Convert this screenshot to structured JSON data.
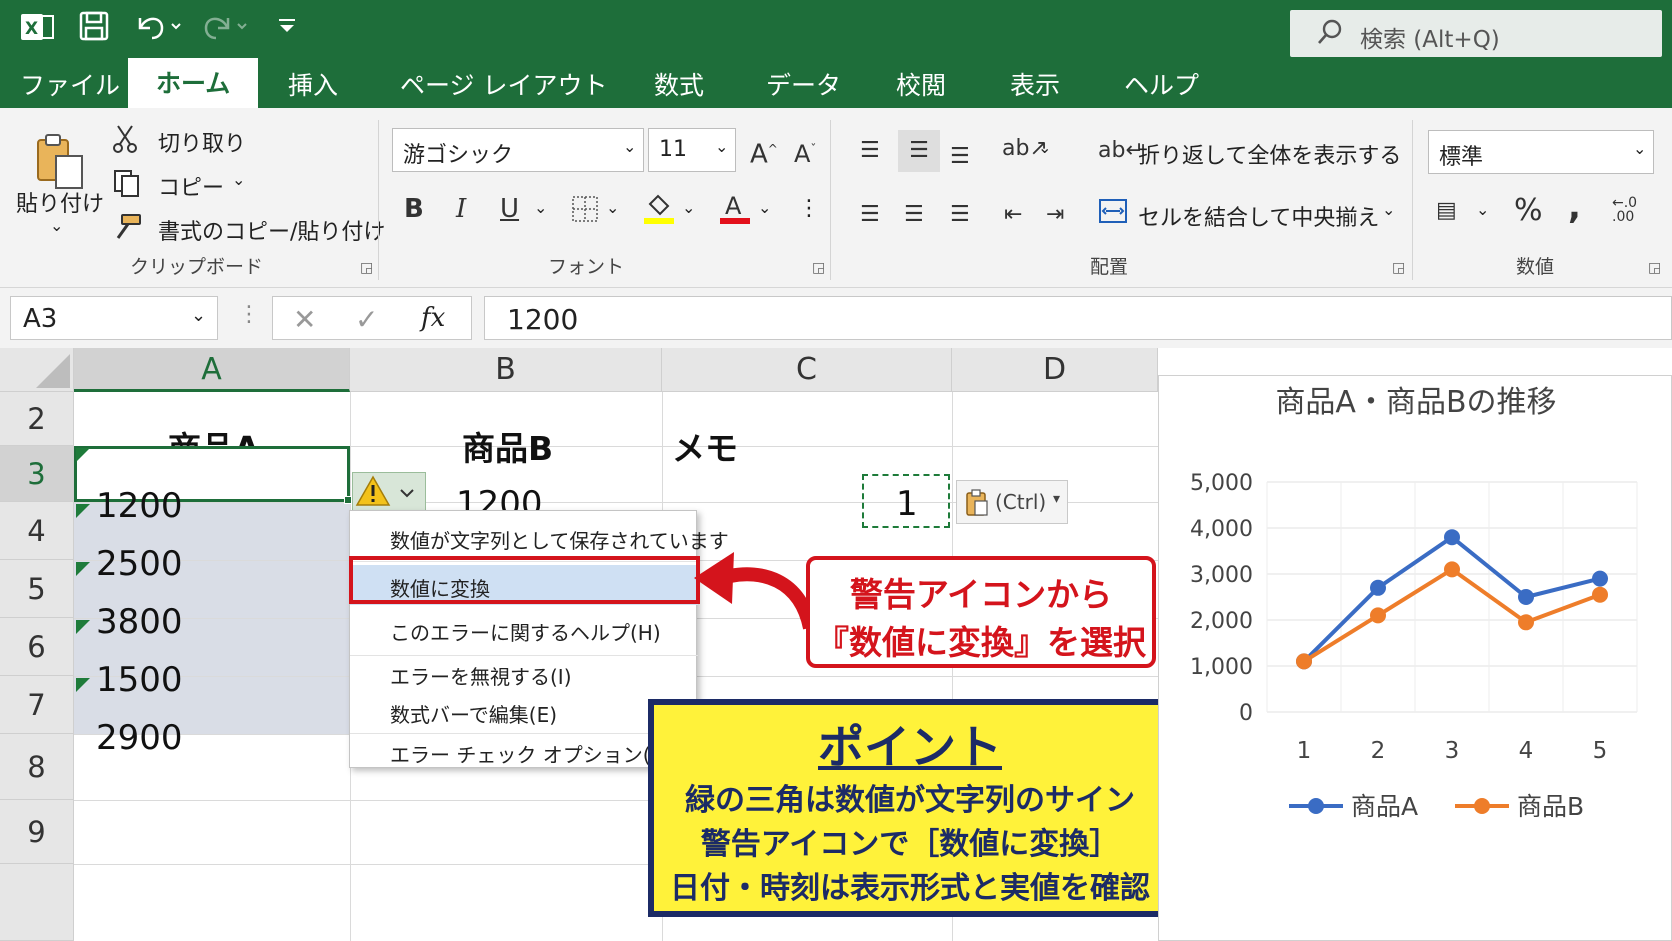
{
  "window": {
    "search_placeholder": "検索 (Alt+Q)",
    "tabs": [
      "ファイル",
      "ホーム",
      "挿入",
      "ページ レイアウト",
      "数式",
      "データ",
      "校閲",
      "表示",
      "ヘルプ"
    ],
    "active_tab": "ホーム"
  },
  "ribbon": {
    "clipboard": {
      "paste": "貼り付け",
      "cut": "切り取り",
      "copy": "コピー",
      "format_painter": "書式のコピー/貼り付け",
      "group": "クリップボード"
    },
    "font": {
      "font_name": "游ゴシック",
      "font_size": "11",
      "group": "フォント"
    },
    "alignment": {
      "wrap_text": "折り返して全体を表示する",
      "merge_center": "セルを結合して中央揃え",
      "group": "配置"
    },
    "number": {
      "format": "標準",
      "group": "数値"
    }
  },
  "formula_bar": {
    "name_box": "A3",
    "formula": "1200"
  },
  "sheet": {
    "columns": [
      "A",
      "B",
      "C",
      "D"
    ],
    "rows": [
      "2",
      "3",
      "4",
      "5",
      "6",
      "7",
      "8",
      "9"
    ],
    "headers": {
      "A": "商品A",
      "B": "商品B",
      "C": "メモ"
    },
    "col_a_values": [
      "1200",
      "2500",
      "3800",
      "1500",
      "2900"
    ],
    "b3": "1200",
    "d3": "1",
    "paste_options": "(Ctrl)"
  },
  "context_menu": {
    "items": [
      "数値が文字列として保存されています",
      "数値に変換",
      "このエラーに関するヘルプ(H)",
      "エラーを無視する(I)",
      "数式バーで編集(E)",
      "エラー チェック オプション(O)..."
    ],
    "highlighted": "数値に変換"
  },
  "callout": {
    "line1": "警告アイコンから",
    "line2": "『数値に変換』を選択"
  },
  "point_box": {
    "title": "ポイント",
    "lines": [
      "緑の三角は数値が文字列のサイン",
      "警告アイコンで［数値に変換］",
      "日付・時刻は表示形式と実値を確認"
    ]
  },
  "colors": {
    "excel_green": "#1e6e3a",
    "series_a": "#3a6cc4",
    "series_b": "#ee7d2a",
    "callout_red": "#d4141c",
    "point_yellow": "#fff23a",
    "point_navy": "#1c2b66"
  },
  "chart_data": {
    "type": "line",
    "title": "商品A・商品Bの推移",
    "x": [
      1,
      2,
      3,
      4,
      5
    ],
    "series": [
      {
        "name": "商品A",
        "values": [
          1100,
          2700,
          3800,
          2500,
          2900
        ]
      },
      {
        "name": "商品B",
        "values": [
          1100,
          2100,
          3100,
          1950,
          2550
        ]
      }
    ],
    "ylim": [
      0,
      5000
    ],
    "yticks": [
      "5,000",
      "4,000",
      "3,000",
      "2,000",
      "1,000",
      "0"
    ],
    "xticks": [
      "1",
      "2",
      "3",
      "4",
      "5"
    ],
    "legend": "bottom",
    "grid": true
  }
}
